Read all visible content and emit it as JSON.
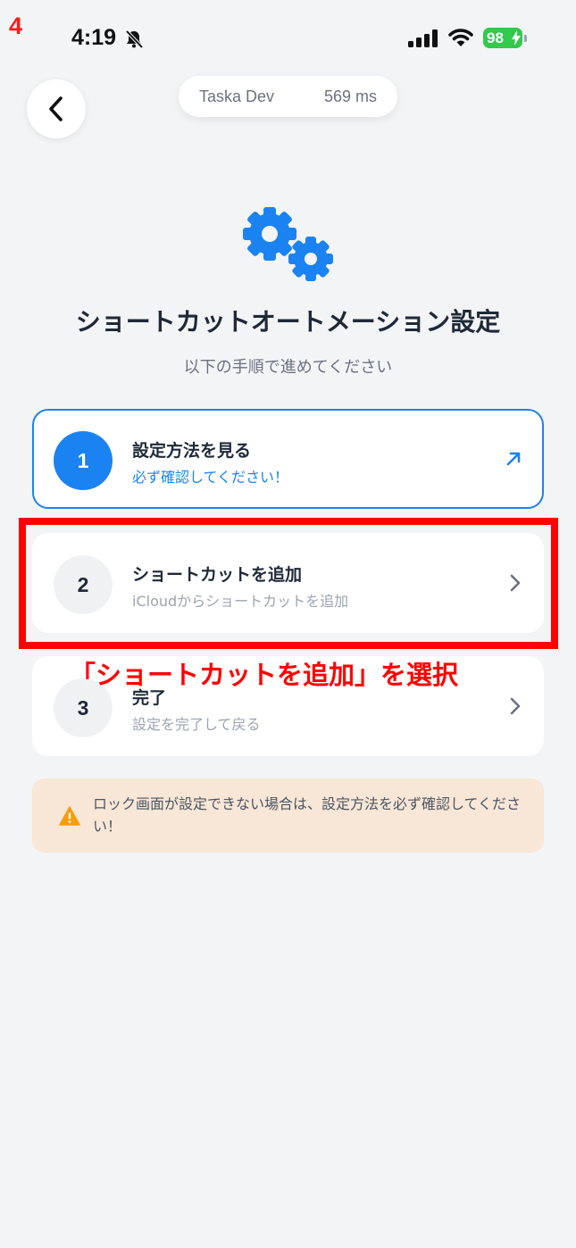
{
  "step_number": "4",
  "status_bar": {
    "time": "4:19",
    "battery": "98"
  },
  "dev_overlay": {
    "app": "Taska Dev",
    "latency": "569 ms"
  },
  "header": {
    "title": "ショートカットオートメーション設定",
    "subtitle": "以下の手順で進めてください"
  },
  "steps": [
    {
      "number": "1",
      "title": "設定方法を見る",
      "desc": "必ず確認してください！",
      "icon": "external-link-icon"
    },
    {
      "number": "2",
      "title": "ショートカットを追加",
      "desc": "iCloudからショートカットを追加",
      "icon": "chevron-right-icon"
    },
    {
      "number": "3",
      "title": "完了",
      "desc": "設定を完了して戻る",
      "icon": "chevron-right-icon"
    }
  ],
  "warning": {
    "text": "ロック画面が設定できない場合は、設定方法を必ず確認してください！"
  },
  "annotation": {
    "callout": "「ショートカットを追加」を選択"
  },
  "colors": {
    "accent": "#1B82F2",
    "annotation": "#FF0000",
    "warning_bg": "#F8E6D6",
    "warning_icon": "#F59E0B",
    "battery": "#33C94A"
  }
}
